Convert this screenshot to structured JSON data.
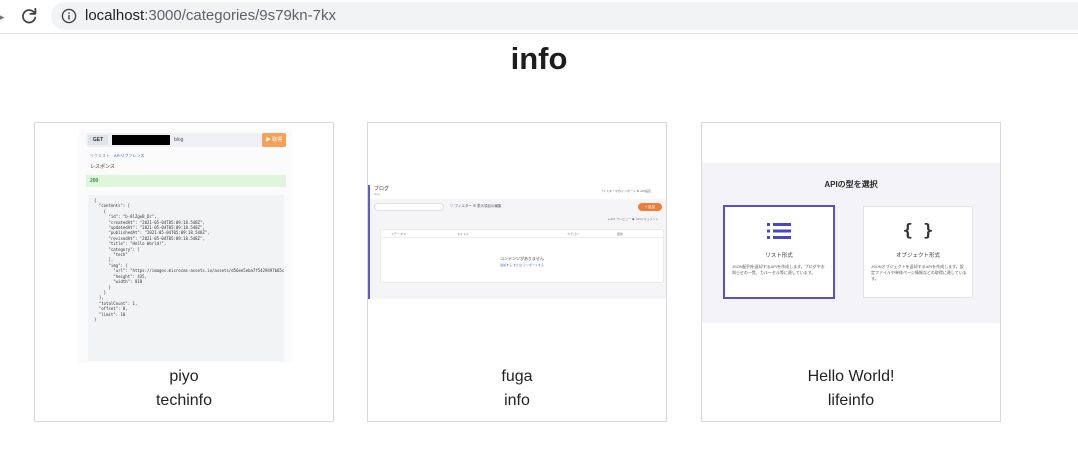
{
  "browser": {
    "url_host": "localhost",
    "url_path": ":3000/categories/9s79kn-7kx"
  },
  "page": {
    "title": "info"
  },
  "cards": [
    {
      "title": "piyo",
      "category": "techinfo",
      "thumb": {
        "method": "GET",
        "endpoint": "blog",
        "send_label": "▶ 取得",
        "tabs": [
          "リクエスト",
          "APIリファレンス"
        ],
        "response_label": "レスポンス",
        "status": "200",
        "json": "{\n  \"contents\": [\n    {\n      \"id\": \"b-8lZgeB_Dr\",\n      \"createdAt\": \"2021-05-04T05:09:18.548Z\",\n      \"updatedAt\": \"2021-05-04T05:09:18.548Z\",\n      \"publishedAt\": \"2021-05-04T05:09:18.548Z\",\n      \"revisedAt\": \"2021-05-04T05:09:18.548Z\",\n      \"title\": \"Hello World!\",\n      \"category\": [\n        \"tech\"\n      ],\n      \"img\": {\n        \"url\": \"https://images.microcms-assets.io/assets/d56ee5eba7f5429497b65c0\",\n        \"height\": 435,\n        \"width\": 818\n      }\n    }\n  ],\n  \"totalCount\": 1,\n  \"offset\": 0,\n  \"limit\": 10\n}"
      }
    },
    {
      "title": "fuga",
      "category": "info",
      "thumb": {
        "app_title": "ブログ",
        "app_sub": "blog",
        "header_right": "⇅ スキーマのインポート   ⚙ API設定",
        "filter": "▽ フィルター   ☰ 表示項目の編集",
        "add_label": "+ 追加",
        "links": "● API プレビュー   ▶ APIドキュメント",
        "col_status": "ステータス",
        "col_title": "タイトル",
        "col_category": "カテゴリ",
        "col_date": "更新",
        "empty": "コンテンツがありません",
        "empty_link": "追加する  または  インポートする"
      }
    },
    {
      "title": "Hello World!",
      "category": "lifeinfo",
      "thumb": {
        "heading": "APIの型を選択",
        "list_title": "リスト形式",
        "list_desc": "JSON配列を返却するAPIを作成します。ブログやお知らせの一覧、カルーセル等に適しています。",
        "object_icon": "{ }",
        "object_title": "オブジェクト形式",
        "object_desc": "JSONオブジェクトを返却するAPIを作成します。設定ファイルや単体ページ情報などの取得に適しています。"
      }
    }
  ]
}
